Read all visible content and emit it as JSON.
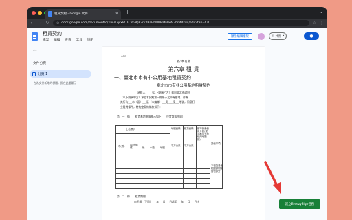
{
  "browser": {
    "tab_title": "租賃契約 - Google 文件",
    "url": "docs.google.com/document/d/1w-rLqcxkOTCPkAQF2rk2Bl-BhM0Ra6iLkAi3bn44kvx/edit?tab=t.0"
  },
  "docs": {
    "title": "租賃契約",
    "menus": [
      "檔案",
      "編輯",
      "查看",
      "工具",
      "說明"
    ],
    "history_button": "顯示編輯權限",
    "share_label": "共用"
  },
  "outline": {
    "title": "文件分頁",
    "tab_label": "分頁 1",
    "hint": "在為文件新增的標題，即在此處顯示"
  },
  "page": {
    "page_number": "455",
    "chapter_small": "第六章 租 賃",
    "chapter": "第六章 租 賃",
    "section": "一、臺北市市有非公用基地租賃契約",
    "subtitle": "臺北市市有非公用基地租賃契約",
    "p1": "承租人____（以下簡稱乙方）茲向臺北市政府____",
    "p2": "（以下簡稱甲方）承租本契約第一條所示之市有基地，作為",
    "p3": "其所有___市（區）___區（市鎮鄉）___段___段___地號，同意訂",
    "p4": "立租賃條件，特約定契約條款如下：",
    "art1": "第　一　條　　租賃基地座落標示如下：（位置詳如附圖）",
    "table": {
      "h_loc": "土地標示",
      "h_area": "地號面積",
      "h_rent": "租賃面積",
      "h_zone": "都市計畫使用分區(或非都市土地使用地類別)",
      "h_use": "土地使用類別",
      "h_other": "其他事項",
      "c_city": "市(縣)",
      "c_dist": "區(市鎮鄉)",
      "c_sec": "段",
      "c_sub": "小段",
      "c_lot": "地號",
      "c_m2a": "平方公尺",
      "c_m2b": "平方公尺",
      "note": "本租賃基地範圍詳附圖套色部分"
    },
    "art2": "第　二　條　　租賃期間：",
    "art2b": "自民國（下同）___年___月___日起至___年___月___日止"
  },
  "extension_button": "建立BreezySign任務",
  "colors": {
    "background": "#f09a86",
    "docs_blue": "#0b57d0",
    "extension_green": "#188038",
    "arrow_red": "#e53935"
  }
}
